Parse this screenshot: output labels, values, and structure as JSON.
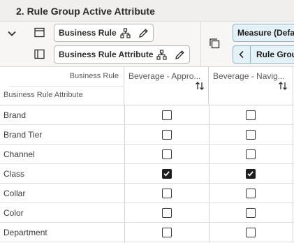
{
  "title": "2. Rule Group Active Attribute",
  "toolbar": {
    "expand_icon": "chevron-down-icon",
    "row1": {
      "icon": "panel-top-icon",
      "chip_label": "Business Rule",
      "hierarchy_icon": "hierarchy-icon",
      "edit_icon": "pencil-icon"
    },
    "row2": {
      "icon": "panel-left-icon",
      "chip_label": "Business Rule Attribute",
      "hierarchy_icon": "hierarchy-icon",
      "edit_icon": "pencil-icon"
    },
    "pivot_icon": "pivot-icon",
    "measure_label": "Measure (Defa",
    "rule_group_label": "Rule Grou",
    "prev_icon": "chevron-left-icon"
  },
  "grid": {
    "corner_col_header": "Business Rule",
    "corner_row_header": "Business Rule Attribute",
    "columns": [
      {
        "label": "Beverage - Appro...",
        "sort_icon": "sort-icon"
      },
      {
        "label": "Beverage - Navig...",
        "sort_icon": "sort-icon"
      }
    ],
    "rows": [
      {
        "label": "Brand",
        "values": [
          false,
          false
        ]
      },
      {
        "label": "Brand Tier",
        "values": [
          false,
          false
        ]
      },
      {
        "label": "Channel",
        "values": [
          false,
          false
        ]
      },
      {
        "label": "Class",
        "values": [
          true,
          true
        ]
      },
      {
        "label": "Collar",
        "values": [
          false,
          false
        ]
      },
      {
        "label": "Color",
        "values": [
          false,
          false
        ]
      },
      {
        "label": "Department",
        "values": [
          false,
          false
        ]
      }
    ]
  }
}
